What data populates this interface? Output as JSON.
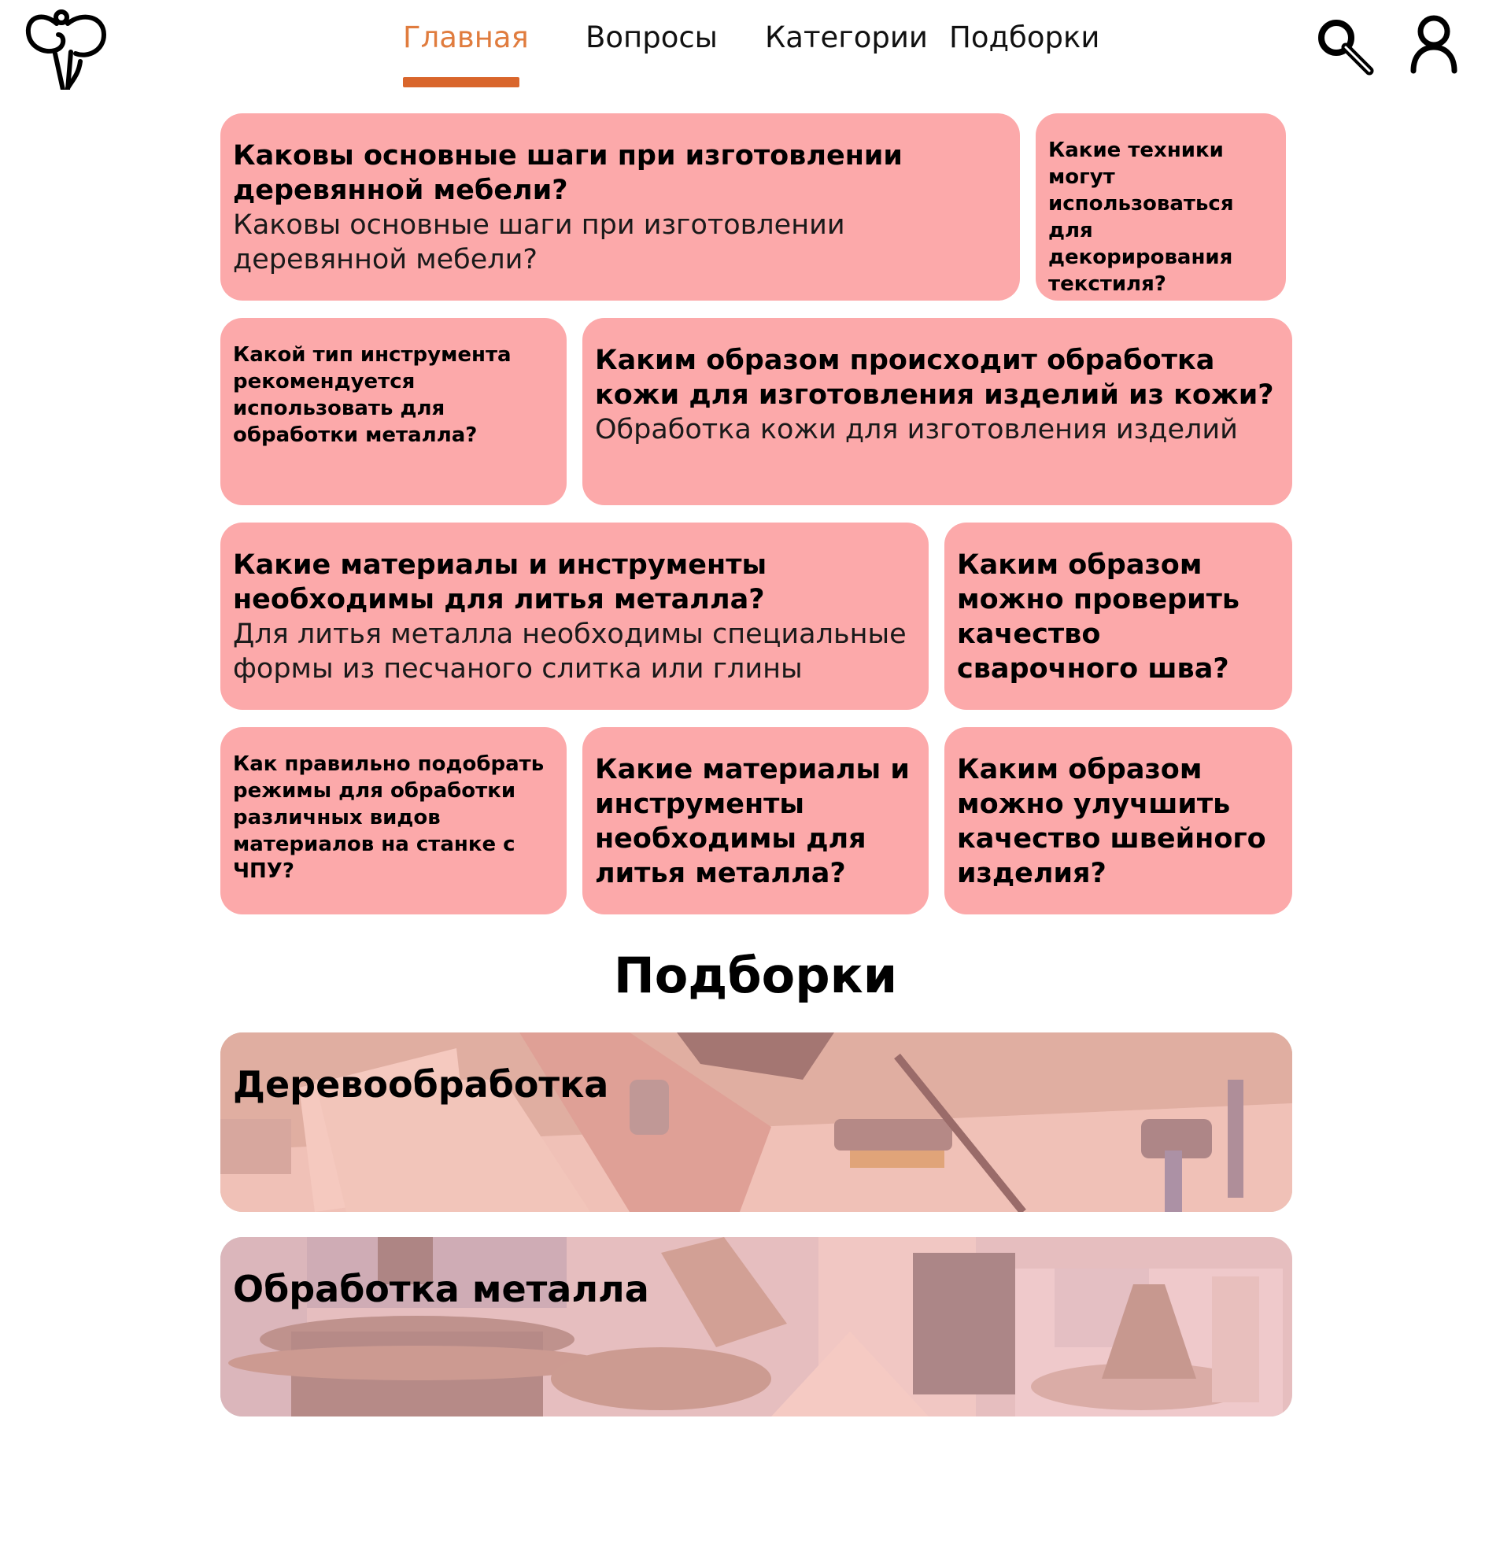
{
  "nav": {
    "items": [
      {
        "label": "Главная",
        "active": true
      },
      {
        "label": "Вопросы",
        "active": false
      },
      {
        "label": "Категории",
        "active": false
      },
      {
        "label": "Подборки",
        "active": false
      }
    ],
    "active_color": "#e07c3e"
  },
  "icons": {
    "logo": "logo-icon",
    "search": "search-icon",
    "profile": "user-icon"
  },
  "cards": [
    {
      "title": "Каковы основные шаги при изготовлении деревянной мебели?",
      "subtitle": "Каковы основные шаги при изготовлении деревянной мебели?"
    },
    {
      "title": "Какие техники могут использоваться для декорирования текстиля?"
    },
    {
      "title": "Какой тип инструмента рекомендуется использовать для обработки металла?"
    },
    {
      "title": "Каким образом происходит обработка кожи для изготовления изделий из кожи?",
      "subtitle": "Обработка кожи для изготовления изделий"
    },
    {
      "title": "Какие материалы и инструменты необходимы для литья металла?",
      "subtitle": "Для литья металла необходимы специальные формы из песчаного слитка или глины"
    },
    {
      "title": "Каким образом можно проверить качество сварочного шва?"
    },
    {
      "title": "Как правильно подобрать режимы для обработки различных видов материалов на станке с ЧПУ?"
    },
    {
      "title": "Какие материалы и инструменты необходимы для литья металла?"
    },
    {
      "title": "Каким образом можно улучшить качество швейного изделия?"
    }
  ],
  "card_color": "#fca9aa",
  "collections": {
    "title": "Подборки",
    "items": [
      {
        "label": "Деревообработка"
      },
      {
        "label": "Обработка металла"
      }
    ]
  }
}
